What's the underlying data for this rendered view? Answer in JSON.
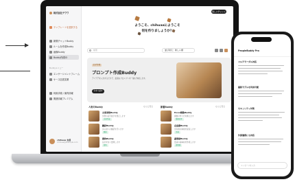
{
  "sidebar": {
    "logo": "株式会社チワワ",
    "items": [
      {
        "label": "テンプレートを選択する"
      },
      {
        "label": "新規チャットBuddy"
      },
      {
        "label": "ルームを作成Buddy"
      },
      {
        "label": "画像Buddy"
      },
      {
        "label": "Buddy作成ID"
      }
    ],
    "section_label": "Buddyメニュー",
    "items2": [
      {
        "label": "エンゲージメントフレーム"
      },
      {
        "label": "ケース記述支援"
      }
    ],
    "items3": [
      {
        "label": "利用手順 / 案内情報"
      },
      {
        "label": "関連情報プレミアム"
      }
    ],
    "user": {
      "name": "chihuaa 太郎",
      "email": "chihuaa@example.com"
    }
  },
  "header": {
    "button": "新しいチャット",
    "welcome_line1": "ようこそ、chihuaaにようこそ",
    "welcome_line2": "何を作りましょうか？"
  },
  "search": {
    "placeholder": "検索"
  },
  "filter": {
    "value": "並び替え：新しい順"
  },
  "banner": {
    "badge": "おすすめ",
    "title": "プロンプト作成Buddy",
    "description": "アイデアを入力するだけで、最適なプロンプトを一緒に作成します。",
    "button": "今すぐ試す"
  },
  "columns": [
    {
      "title": "人気のBuddy",
      "more": "もっと見る"
    },
    {
      "title": "新着Buddy",
      "more": "もっと見る"
    }
  ],
  "cards_left": [
    {
      "title": "文章添削Buddy",
      "desc": "文章の誤字脱字を修正します",
      "tag": "文章作成"
    },
    {
      "title": "翻訳Buddy",
      "desc": "多言語への翻訳を行います",
      "tag": "翻訳"
    },
    {
      "title": "要約Buddy",
      "desc": "長文を短く要約します",
      "tag": "要約"
    }
  ],
  "cards_right": [
    {
      "title": "Excel関数Buddy",
      "desc": "関数の作り方を教えます",
      "tag": "業務効率"
    },
    {
      "title": "企画書Buddy",
      "desc": "企画書の構成を提案します",
      "tag": "企画"
    },
    {
      "title": "議事録Buddy",
      "desc": "会議の議事録を作成します",
      "tag": "議事録"
    }
  ],
  "phone": {
    "header": "PeopleBuddy Pro",
    "sections": [
      {
        "heading": "マルチモーダル対応"
      },
      {
        "heading": "最新モデルを利用可能"
      },
      {
        "heading": "セキュリティ対策"
      },
      {
        "heading": "外部連携にも対応"
      }
    ],
    "input_placeholder": "メッセージを入力"
  }
}
